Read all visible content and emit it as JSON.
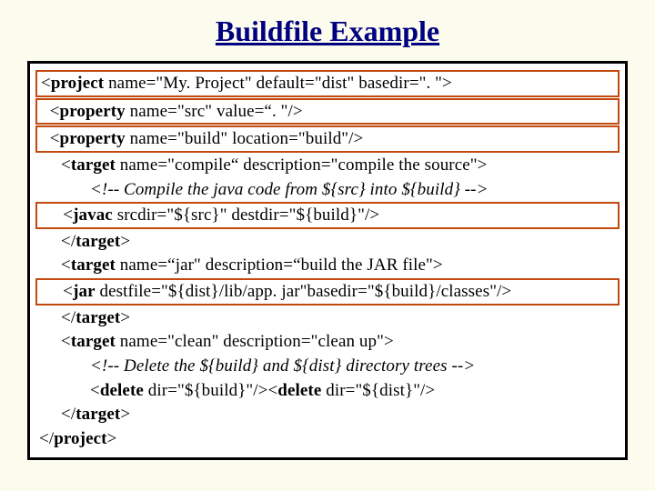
{
  "title": "Buildfile Example",
  "lines": [
    {
      "boxed": true,
      "indent": 0,
      "segs": [
        {
          "t": "<",
          "b": 0
        },
        {
          "t": "project",
          "b": 1
        },
        {
          "t": " name=\"My. Project\" default=\"dist\" basedir=\". \">",
          "b": 0
        }
      ]
    },
    {
      "boxed": true,
      "indent": 1,
      "segs": [
        {
          "t": "<",
          "b": 0
        },
        {
          "t": "property",
          "b": 1
        },
        {
          "t": " name=\"src\" value=“. \"/>",
          "b": 0
        }
      ]
    },
    {
      "boxed": true,
      "indent": 1,
      "segs": [
        {
          "t": "<",
          "b": 0
        },
        {
          "t": "property",
          "b": 1
        },
        {
          "t": " name=\"build\" location=\"build\"/>",
          "b": 0
        }
      ]
    },
    {
      "boxed": false,
      "indent": 1,
      "segs": [
        {
          "t": "<",
          "b": 0
        },
        {
          "t": "target",
          "b": 1
        },
        {
          "t": " name=\"compile“ description=\"compile the source\">",
          "b": 0
        }
      ]
    },
    {
      "boxed": false,
      "indent": 2,
      "italic": true,
      "segs": [
        {
          "t": "<!-- Compile the java code from ${src} into ${build} -->",
          "b": 0
        }
      ]
    },
    {
      "boxed": true,
      "indent": 2,
      "segs": [
        {
          "t": "<",
          "b": 0
        },
        {
          "t": "javac",
          "b": 1
        },
        {
          "t": " srcdir=\"${src}\" destdir=\"${build}\"/>",
          "b": 0
        }
      ]
    },
    {
      "boxed": false,
      "indent": 1,
      "segs": [
        {
          "t": "</",
          "b": 0
        },
        {
          "t": "target",
          "b": 1
        },
        {
          "t": ">",
          "b": 0
        }
      ]
    },
    {
      "boxed": false,
      "indent": 1,
      "segs": [
        {
          "t": "<",
          "b": 0
        },
        {
          "t": "target",
          "b": 1
        },
        {
          "t": " name=“jar\" description=“build the JAR file\">",
          "b": 0
        }
      ]
    },
    {
      "boxed": true,
      "indent": 2,
      "segs": [
        {
          "t": "<",
          "b": 0
        },
        {
          "t": "jar",
          "b": 1
        },
        {
          "t": " destfile=\"${dist}/lib/app. jar\"basedir=\"${build}/classes\"/>",
          "b": 0
        }
      ]
    },
    {
      "boxed": false,
      "indent": 1,
      "segs": [
        {
          "t": "</",
          "b": 0
        },
        {
          "t": "target",
          "b": 1
        },
        {
          "t": ">",
          "b": 0
        }
      ]
    },
    {
      "boxed": false,
      "indent": 1,
      "segs": [
        {
          "t": "<",
          "b": 0
        },
        {
          "t": "target",
          "b": 1
        },
        {
          "t": " name=\"clean\" description=\"clean up\">",
          "b": 0
        }
      ]
    },
    {
      "boxed": false,
      "indent": 2,
      "italic": true,
      "segs": [
        {
          "t": "<!-- Delete the ${build} and ${dist} directory trees -->",
          "b": 0
        }
      ]
    },
    {
      "boxed": false,
      "indent": 2,
      "segs": [
        {
          "t": "<",
          "b": 0
        },
        {
          "t": "delete",
          "b": 1
        },
        {
          "t": " dir=\"${build}\"/><",
          "b": 0
        },
        {
          "t": "delete",
          "b": 1
        },
        {
          "t": " dir=\"${dist}\"/>",
          "b": 0
        }
      ]
    },
    {
      "boxed": false,
      "indent": 1,
      "segs": [
        {
          "t": "</",
          "b": 0
        },
        {
          "t": "target",
          "b": 1
        },
        {
          "t": ">",
          "b": 0
        }
      ]
    },
    {
      "boxed": false,
      "indent": 0,
      "segs": [
        {
          "t": "</",
          "b": 0
        },
        {
          "t": "project",
          "b": 1
        },
        {
          "t": ">",
          "b": 0
        }
      ]
    }
  ]
}
